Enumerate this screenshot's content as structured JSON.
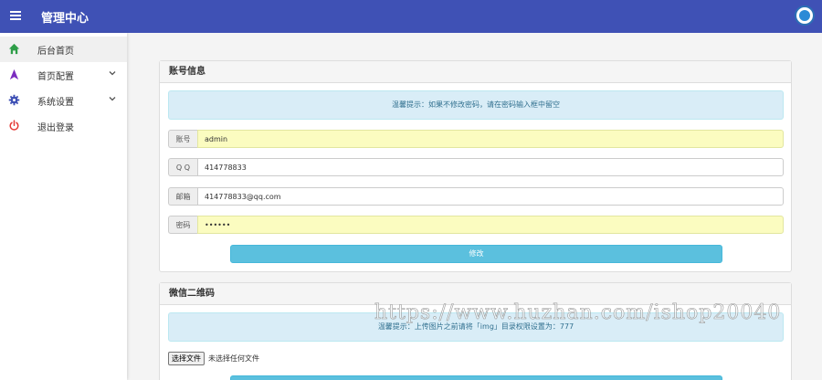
{
  "header": {
    "title": "管理中心"
  },
  "sidebar": {
    "items": [
      {
        "label": "后台首页",
        "icon": "home-icon",
        "color": "#2e9e48"
      },
      {
        "label": "首页配置",
        "icon": "navigation-icon",
        "color": "#7b2cbf"
      },
      {
        "label": "系统设置",
        "icon": "gear-icon",
        "color": "#3f51b5"
      },
      {
        "label": "退出登录",
        "icon": "power-icon",
        "color": "#e53935"
      }
    ]
  },
  "account_panel": {
    "title": "账号信息",
    "notice": "温馨提示：如果不修改密码，请在密码输入框中留空",
    "fields": [
      {
        "label": "账号",
        "value": "admin"
      },
      {
        "label": "Q Q",
        "value": "414778833"
      },
      {
        "label": "邮箱",
        "value": "414778833@qq.com"
      },
      {
        "label": "密码",
        "value": "••••••"
      }
    ],
    "submit_label": "修改"
  },
  "qrcode_panel": {
    "title": "微信二维码",
    "notice": "温馨提示：上传图片之前请将「img」目录权限设置为：777",
    "file_button": "选择文件",
    "file_status": "未选择任何文件"
  },
  "watermark": "https://www.huzhan.com/ishop20040"
}
